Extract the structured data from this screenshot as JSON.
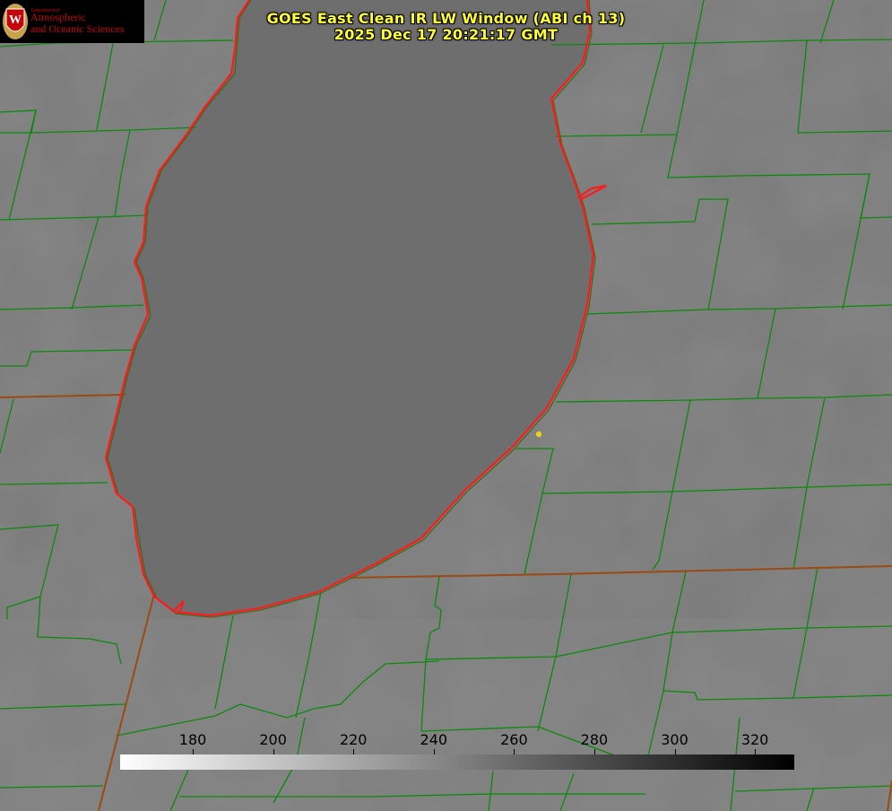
{
  "title_line1": "GOES East Clean IR LW Window (ABI ch 13)",
  "title_line2": "2025 Dec 17 20:21:17 GMT",
  "logo": {
    "dept": "Department of",
    "line1": "Atmospheric",
    "line2": "and Oceanic Sciences",
    "shield_letter": "W"
  },
  "colorbar": {
    "ticks": [
      "180",
      "200",
      "220",
      "240",
      "260",
      "280",
      "300",
      "320"
    ],
    "values": [
      180,
      200,
      220,
      240,
      260,
      280,
      300,
      320
    ],
    "min_color": "#ffffff",
    "max_color": "#000000"
  },
  "colors": {
    "county_lines": "#0a8a0a",
    "state_lines": "#9a4a12",
    "coastline": "#ff1a1a",
    "title_text": "#ffff33",
    "marker": "#e8d21a"
  }
}
